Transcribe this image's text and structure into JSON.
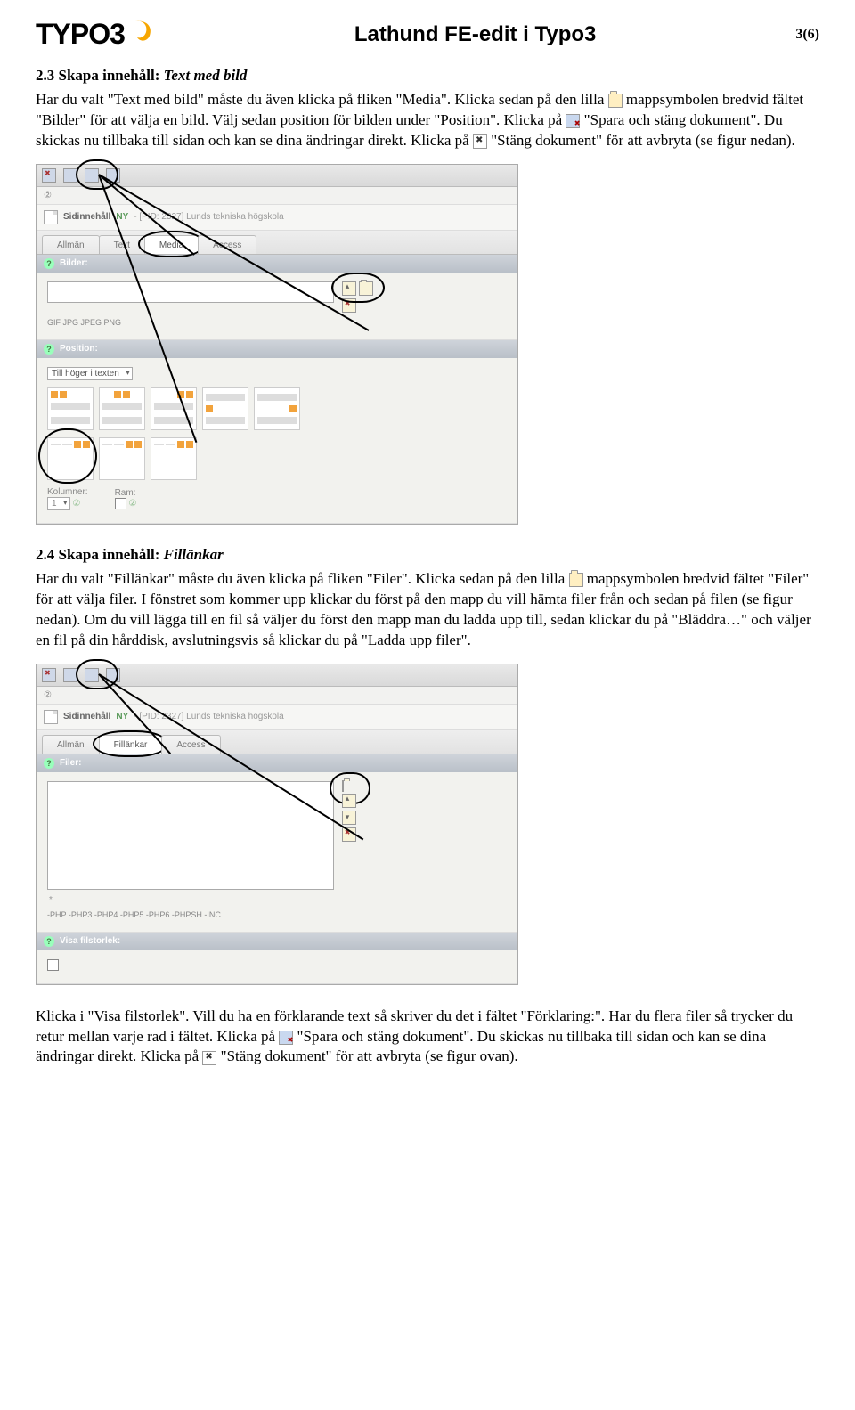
{
  "header": {
    "logo_text": "TYPO3",
    "doc_title": "Lathund FE-edit i Typo3",
    "page_indicator": "3(6)"
  },
  "section23": {
    "heading_lead": "2.3 Skapa innehåll: ",
    "heading_em": "Text med bild",
    "para": "Har du valt \"Text med bild\" måste du även klicka på fliken \"Media\". Klicka sedan på den lilla mappsymbolen bredvid fältet \"Bilder\" för att välja en bild. Välj sedan position för bilden under \"Position\". Klicka på  \"Spara och stäng dokument\". Du skickas nu tillbaka till sidan och kan se dina ändringar direkt. Klicka på  \"Stäng dokument\" för att avbryta (se figur nedan)."
  },
  "shot1": {
    "title_prefix": "Sidinnehåll",
    "title_new": "NY",
    "title_meta": " - [PID: 2327] Lunds tekniska högskola",
    "tabs": [
      "Allmän",
      "Text",
      "Media",
      "Access"
    ],
    "field_bilder": "Bilder:",
    "formats": "GIF JPG JPEG PNG",
    "field_position": "Position:",
    "pos_select": "Till höger i texten",
    "col_label": "Kolumner:",
    "col_val": "1",
    "ram_label": "Ram:"
  },
  "section24": {
    "heading_lead": "2.4 Skapa innehåll: ",
    "heading_em": "Fillänkar",
    "para": "Har du valt \"Fillänkar\" måste du även klicka på fliken \"Filer\". Klicka sedan på den lilla mappsymbolen bredvid fältet \"Filer\" för att välja filer. I fönstret som kommer upp klickar du först på den mapp du vill hämta filer från och sedan på filen (se figur nedan). Om du vill lägga till en fil så väljer du först den mapp man du ladda upp till, sedan klickar du på \"Bläddra…\" och väljer en fil på din hårddisk, avslutningsvis så klickar du på \"Ladda upp filer\"."
  },
  "shot2": {
    "title_prefix": "Sidinnehåll",
    "title_new": "NY",
    "title_meta": " - [PID: 2327] Lunds tekniska högskola",
    "tabs": [
      "Allmän",
      "Fillänkar",
      "Access"
    ],
    "field_filer": "Filer:",
    "formats_excl": "-PHP -PHP3 -PHP4 -PHP5 -PHP6 -PHPSH -INC",
    "field_visa": "Visa filstorlek:"
  },
  "closing": {
    "para": "Klicka i \"Visa filstorlek\". Vill du ha en förklarande text så skriver du det i fältet \"Förklaring:\". Har du flera filer så trycker du retur mellan varje rad i fältet. Klicka på  \"Spara och stäng dokument\". Du skickas nu tillbaka till sidan och kan se dina ändringar direkt. Klicka på  \"Stäng dokument\" för att avbryta (se figur ovan)."
  }
}
